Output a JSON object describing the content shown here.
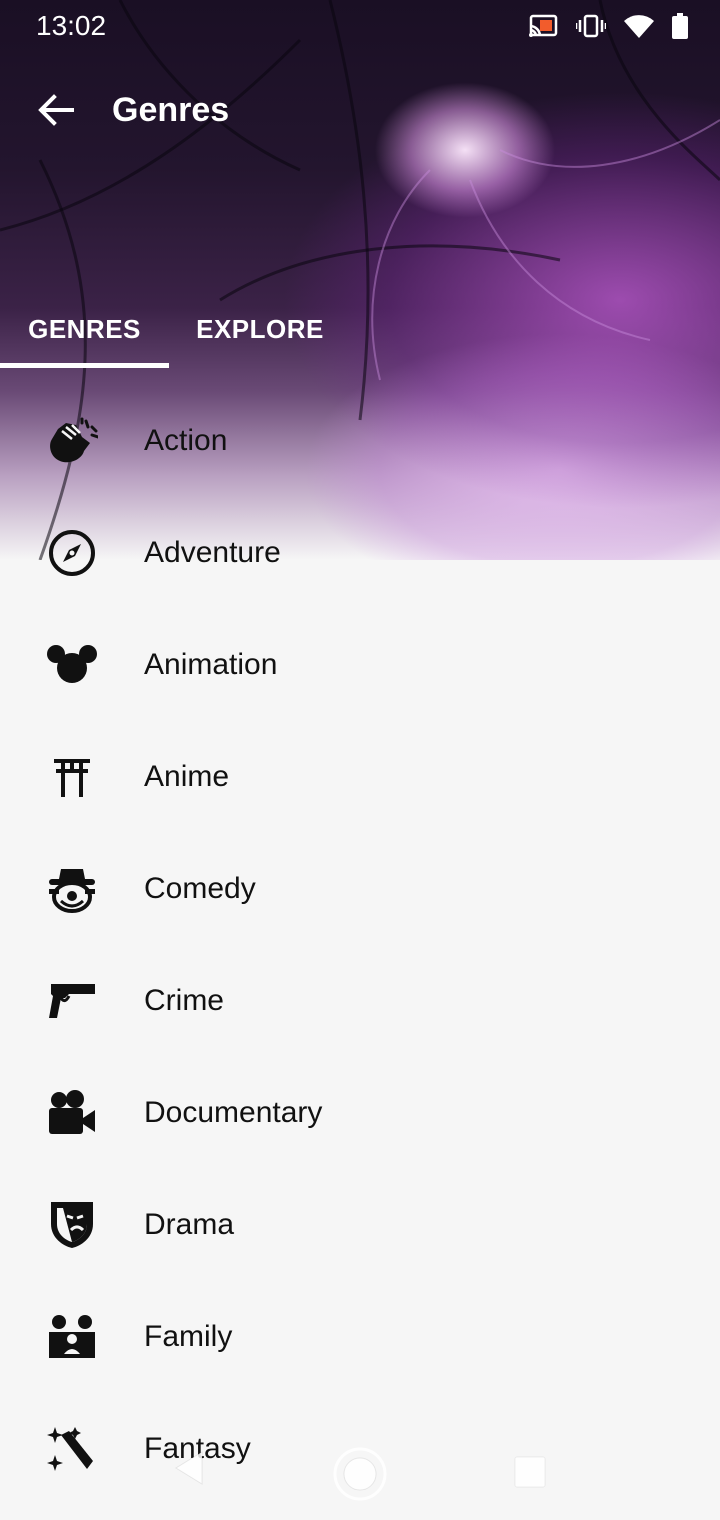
{
  "status_bar": {
    "time": "13:02",
    "icons": [
      "cast-icon",
      "vibrate-icon",
      "wifi-icon",
      "battery-icon"
    ]
  },
  "app_bar": {
    "title": "Genres",
    "back_icon": "arrow-back-icon"
  },
  "tabs": [
    {
      "label": "GENRES",
      "selected": true
    },
    {
      "label": "EXPLORE",
      "selected": false
    }
  ],
  "genres": [
    {
      "label": "Action",
      "icon": "fist-icon"
    },
    {
      "label": "Adventure",
      "icon": "compass-icon"
    },
    {
      "label": "Animation",
      "icon": "mickey-icon"
    },
    {
      "label": "Anime",
      "icon": "torii-icon"
    },
    {
      "label": "Comedy",
      "icon": "clown-icon"
    },
    {
      "label": "Crime",
      "icon": "pistol-icon"
    },
    {
      "label": "Documentary",
      "icon": "video-camera-icon"
    },
    {
      "label": "Drama",
      "icon": "theater-mask-icon"
    },
    {
      "label": "Family",
      "icon": "family-icon"
    },
    {
      "label": "Fantasy",
      "icon": "magic-wand-icon"
    }
  ],
  "nav_bar": {
    "buttons": [
      "back-nav-icon",
      "home-nav-icon",
      "recents-nav-icon"
    ]
  }
}
